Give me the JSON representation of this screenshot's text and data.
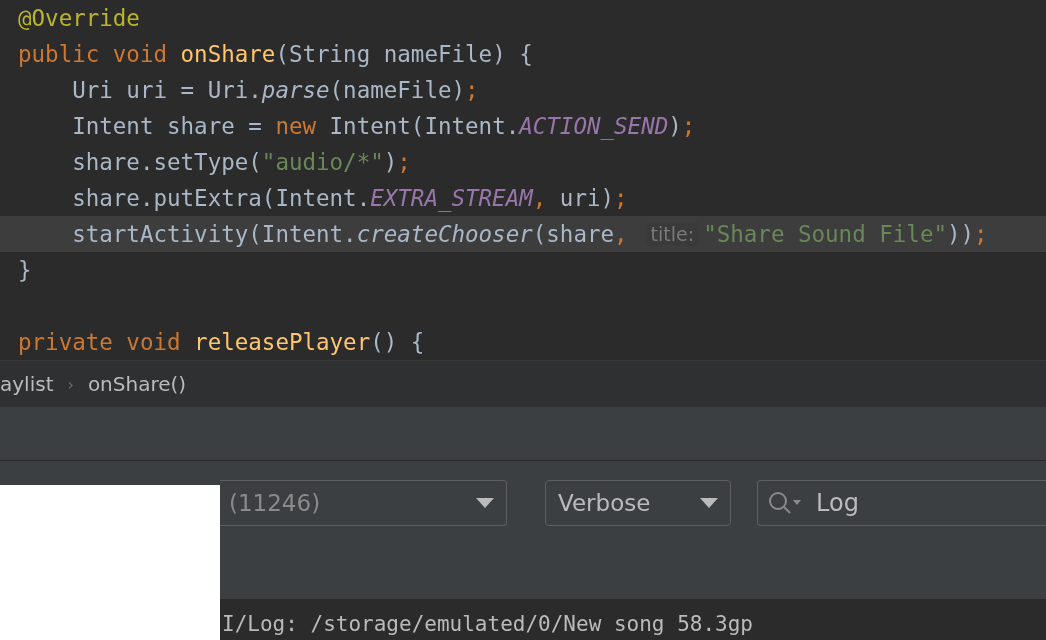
{
  "editor": {
    "lines": [
      {
        "highlighted": false,
        "tokens": [
          {
            "kind": "annotation",
            "text": "@Override"
          }
        ]
      },
      {
        "highlighted": false,
        "tokens": [
          {
            "kind": "keyword",
            "text": "public void "
          },
          {
            "kind": "method",
            "text": "onShare"
          },
          {
            "kind": "plain",
            "text": "(String nameFile) {"
          }
        ]
      },
      {
        "highlighted": false,
        "tokens": [
          {
            "kind": "plain",
            "text": "    Uri uri = Uri."
          },
          {
            "kind": "static",
            "text": "parse"
          },
          {
            "kind": "plain",
            "text": "(nameFile)"
          },
          {
            "kind": "punct",
            "text": ";"
          }
        ]
      },
      {
        "highlighted": false,
        "tokens": [
          {
            "kind": "plain",
            "text": "    Intent share = "
          },
          {
            "kind": "keyword",
            "text": "new"
          },
          {
            "kind": "plain",
            "text": " Intent(Intent."
          },
          {
            "kind": "constant",
            "text": "ACTION_SEND"
          },
          {
            "kind": "plain",
            "text": ")"
          },
          {
            "kind": "punct",
            "text": ";"
          }
        ]
      },
      {
        "highlighted": false,
        "tokens": [
          {
            "kind": "plain",
            "text": "    share.setType("
          },
          {
            "kind": "string",
            "text": "\"audio/*\""
          },
          {
            "kind": "plain",
            "text": ")"
          },
          {
            "kind": "punct",
            "text": ";"
          }
        ]
      },
      {
        "highlighted": false,
        "tokens": [
          {
            "kind": "plain",
            "text": "    share.putExtra(Intent."
          },
          {
            "kind": "constant",
            "text": "EXTRA_STREAM"
          },
          {
            "kind": "punct",
            "text": ","
          },
          {
            "kind": "plain",
            "text": " uri)"
          },
          {
            "kind": "punct",
            "text": ";"
          }
        ]
      },
      {
        "highlighted": true,
        "tokens": [
          {
            "kind": "plain",
            "text": "    startActivity(Intent."
          },
          {
            "kind": "static",
            "text": "createChooser"
          },
          {
            "kind": "plain",
            "text": "(share"
          },
          {
            "kind": "punct",
            "text": ","
          },
          {
            "kind": "hint",
            "text": "title:"
          },
          {
            "kind": "string",
            "text": "\"Share Sound File\""
          },
          {
            "kind": "plain",
            "text": "))"
          },
          {
            "kind": "punct",
            "text": ";"
          }
        ]
      },
      {
        "highlighted": false,
        "tokens": [
          {
            "kind": "plain",
            "text": "}"
          }
        ]
      },
      {
        "highlighted": false
      },
      {
        "highlighted": false,
        "tokens": [
          {
            "kind": "keyword",
            "text": "private void "
          },
          {
            "kind": "method",
            "text": "releasePlayer"
          },
          {
            "kind": "plain",
            "text": "() {"
          }
        ]
      }
    ]
  },
  "breadcrumb": {
    "separator": "›",
    "items": [
      "aylist",
      "onShare()"
    ]
  },
  "logcat": {
    "process_dropdown": "(11246)",
    "level_dropdown": "Verbose",
    "search": {
      "value": "Log"
    },
    "lines": [
      "I/Log: /storage/emulated/0/New song 58.3gp"
    ]
  }
}
